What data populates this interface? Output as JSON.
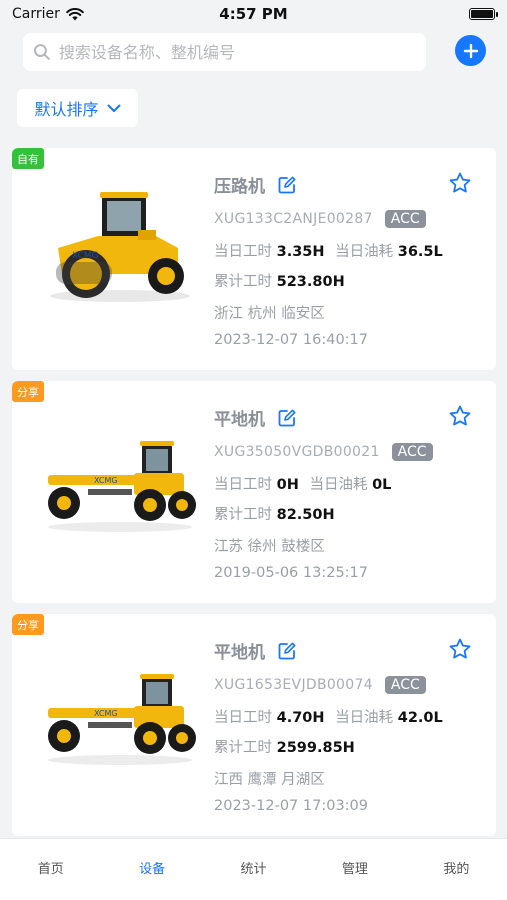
{
  "status_bar": {
    "carrier": "Carrier",
    "time": "4:57 PM",
    "battery_level": 1.0
  },
  "search": {
    "placeholder": "搜索设备名称、整机编号"
  },
  "sort": {
    "label": "默认排序"
  },
  "colors": {
    "accent": "#1677ff",
    "own_tag": "#34c23d",
    "share_tag": "#ff9a1f",
    "acc_badge": "#8b929b"
  },
  "devices": [
    {
      "tag": "自有",
      "tag_type": "own",
      "name": "压路机",
      "image_icon": "road-roller-image",
      "code": "XUG133C2ANJE00287",
      "acc": "ACC",
      "daily_hours_label": "当日工时",
      "daily_hours": "3.35H",
      "daily_fuel_label": "当日油耗",
      "daily_fuel": "36.5L",
      "total_hours_label": "累计工时",
      "total_hours": "523.80H",
      "location": "浙江 杭州 临安区",
      "time": "2023-12-07 16:40:17"
    },
    {
      "tag": "分享",
      "tag_type": "share",
      "name": "平地机",
      "image_icon": "motor-grader-image",
      "code": "XUG35050VGDB00021",
      "acc": "ACC",
      "daily_hours_label": "当日工时",
      "daily_hours": "0H",
      "daily_fuel_label": "当日油耗",
      "daily_fuel": "0L",
      "total_hours_label": "累计工时",
      "total_hours": "82.50H",
      "location": "江苏 徐州 鼓楼区",
      "time": "2019-05-06 13:25:17"
    },
    {
      "tag": "分享",
      "tag_type": "share",
      "name": "平地机",
      "image_icon": "motor-grader-image",
      "code": "XUG1653EVJDB00074",
      "acc": "ACC",
      "daily_hours_label": "当日工时",
      "daily_hours": "4.70H",
      "daily_fuel_label": "当日油耗",
      "daily_fuel": "42.0L",
      "total_hours_label": "累计工时",
      "total_hours": "2599.85H",
      "location": "江西 鹰潭 月湖区",
      "time": "2023-12-07 17:03:09"
    }
  ],
  "tabs": [
    {
      "label": "首页",
      "active": false
    },
    {
      "label": "设备",
      "active": true
    },
    {
      "label": "统计",
      "active": false
    },
    {
      "label": "管理",
      "active": false
    },
    {
      "label": "我的",
      "active": false
    }
  ]
}
